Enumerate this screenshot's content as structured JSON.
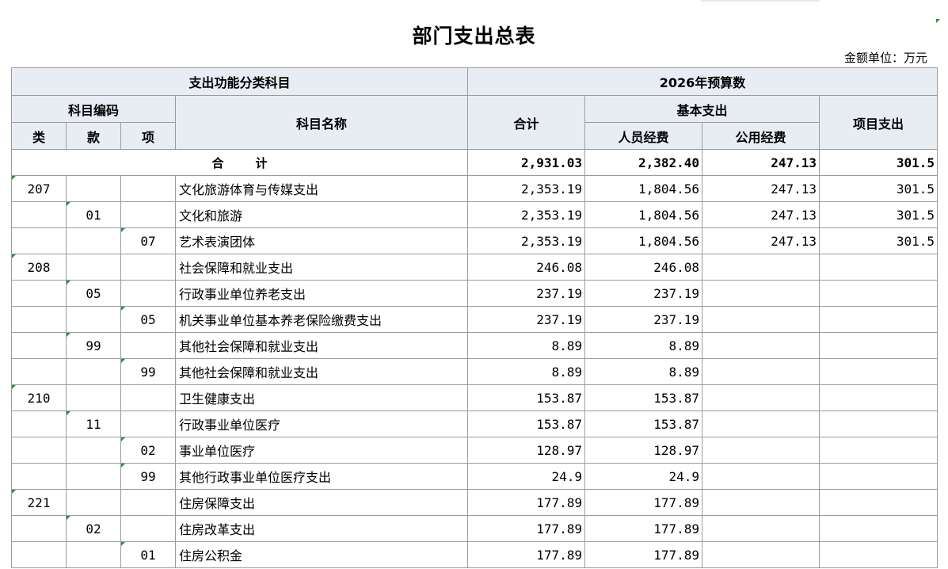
{
  "title": "部门支出总表",
  "unit": "金额单位：万元",
  "header": {
    "func_class": "支出功能分类科目",
    "budget_year": "2026年预算数",
    "code": "科目编码",
    "lei": "类",
    "kuan": "款",
    "xiang": "项",
    "name": "科目名称",
    "total": "合计",
    "basic": "基本支出",
    "personnel": "人员经费",
    "public": "公用经费",
    "project": "项目支出"
  },
  "total_row": {
    "label": "合计",
    "total": "2,931.03",
    "personnel": "2,382.40",
    "public": "247.13",
    "project": "301.5"
  },
  "rows": [
    {
      "lei": "207",
      "kuan": "",
      "xiang": "",
      "name": "文化旅游体育与传媒支出",
      "total": "2,353.19",
      "personnel": "1,804.56",
      "public": "247.13",
      "project": "301.5"
    },
    {
      "lei": "",
      "kuan": "01",
      "xiang": "",
      "name": "文化和旅游",
      "total": "2,353.19",
      "personnel": "1,804.56",
      "public": "247.13",
      "project": "301.5"
    },
    {
      "lei": "",
      "kuan": "",
      "xiang": "07",
      "name": "艺术表演团体",
      "total": "2,353.19",
      "personnel": "1,804.56",
      "public": "247.13",
      "project": "301.5"
    },
    {
      "lei": "208",
      "kuan": "",
      "xiang": "",
      "name": "社会保障和就业支出",
      "total": "246.08",
      "personnel": "246.08",
      "public": "",
      "project": ""
    },
    {
      "lei": "",
      "kuan": "05",
      "xiang": "",
      "name": "行政事业单位养老支出",
      "total": "237.19",
      "personnel": "237.19",
      "public": "",
      "project": ""
    },
    {
      "lei": "",
      "kuan": "",
      "xiang": "05",
      "name": "机关事业单位基本养老保险缴费支出",
      "total": "237.19",
      "personnel": "237.19",
      "public": "",
      "project": ""
    },
    {
      "lei": "",
      "kuan": "99",
      "xiang": "",
      "name": "其他社会保障和就业支出",
      "total": "8.89",
      "personnel": "8.89",
      "public": "",
      "project": ""
    },
    {
      "lei": "",
      "kuan": "",
      "xiang": "99",
      "name": "其他社会保障和就业支出",
      "total": "8.89",
      "personnel": "8.89",
      "public": "",
      "project": ""
    },
    {
      "lei": "210",
      "kuan": "",
      "xiang": "",
      "name": "卫生健康支出",
      "total": "153.87",
      "personnel": "153.87",
      "public": "",
      "project": ""
    },
    {
      "lei": "",
      "kuan": "11",
      "xiang": "",
      "name": "行政事业单位医疗",
      "total": "153.87",
      "personnel": "153.87",
      "public": "",
      "project": ""
    },
    {
      "lei": "",
      "kuan": "",
      "xiang": "02",
      "name": "事业单位医疗",
      "total": "128.97",
      "personnel": "128.97",
      "public": "",
      "project": ""
    },
    {
      "lei": "",
      "kuan": "",
      "xiang": "99",
      "name": "其他行政事业单位医疗支出",
      "total": "24.9",
      "personnel": "24.9",
      "public": "",
      "project": ""
    },
    {
      "lei": "221",
      "kuan": "",
      "xiang": "",
      "name": "住房保障支出",
      "total": "177.89",
      "personnel": "177.89",
      "public": "",
      "project": ""
    },
    {
      "lei": "",
      "kuan": "02",
      "xiang": "",
      "name": "住房改革支出",
      "total": "177.89",
      "personnel": "177.89",
      "public": "",
      "project": ""
    },
    {
      "lei": "",
      "kuan": "",
      "xiang": "01",
      "name": "住房公积金",
      "total": "177.89",
      "personnel": "177.89",
      "public": "",
      "project": ""
    }
  ]
}
